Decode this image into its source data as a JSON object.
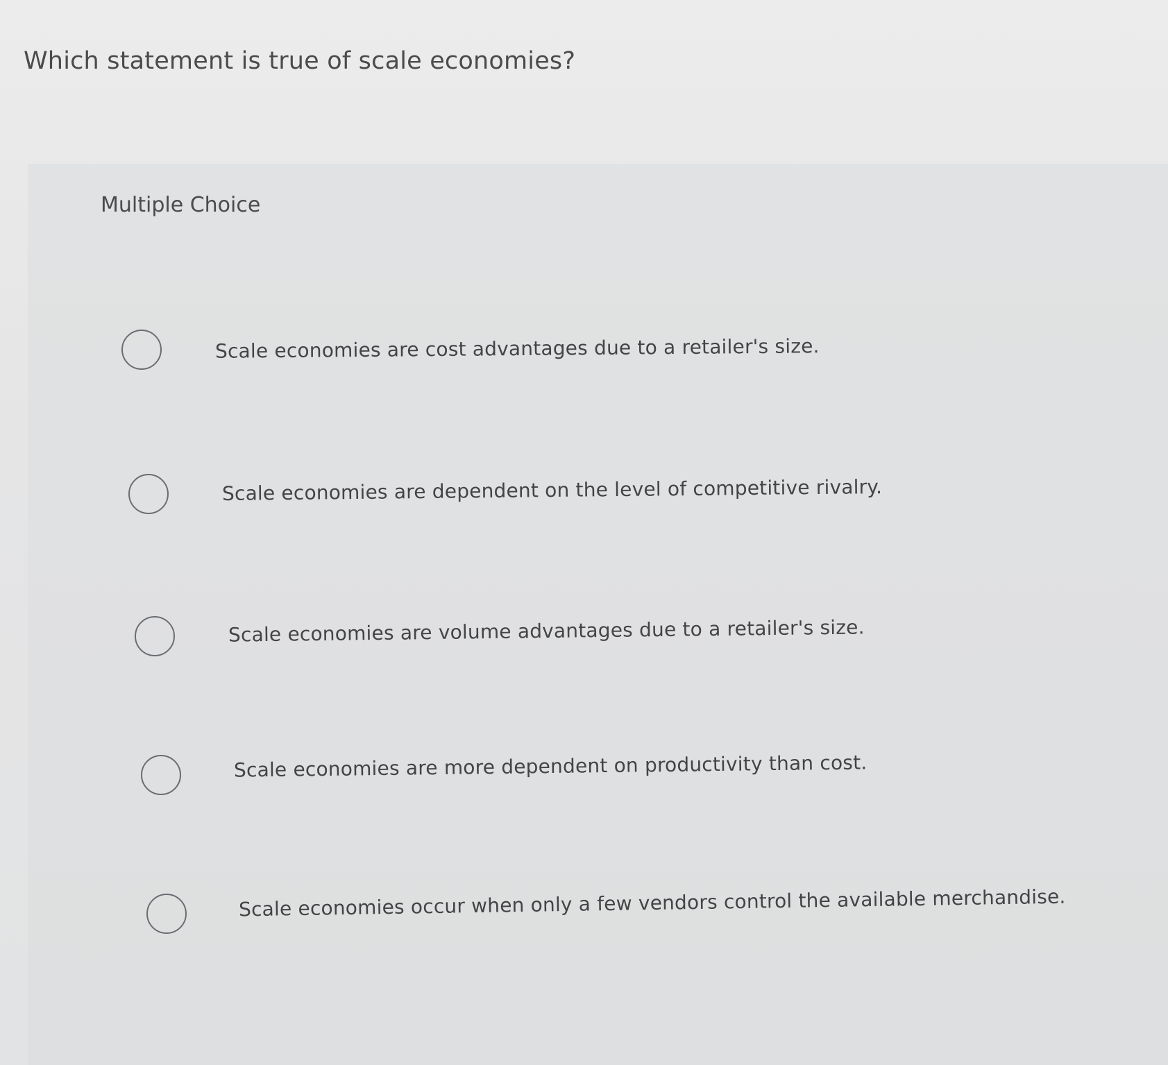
{
  "question": {
    "text": "Which statement is true of scale economies?"
  },
  "section": {
    "label": "Multiple Choice"
  },
  "choices": [
    {
      "label": "Scale economies are cost advantages due to a retailer's size.",
      "selected": false
    },
    {
      "label": "Scale economies are dependent on the level of competitive rivalry.",
      "selected": false
    },
    {
      "label": "Scale economies are volume advantages due to a retailer's size.",
      "selected": false
    },
    {
      "label": "Scale economies are more dependent on productivity than cost.",
      "selected": false
    },
    {
      "label": "Scale economies occur when only a few vendors control the available merchandise.",
      "selected": false
    }
  ]
}
